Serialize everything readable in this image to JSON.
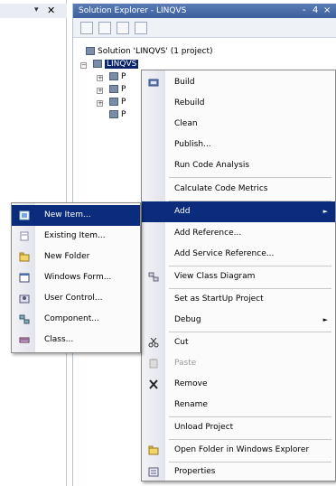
{
  "solution_explorer": {
    "title": "Solution Explorer - LINQVS",
    "solution_label": "Solution 'LINQVS' (1 project)",
    "project_label": "LINQVS",
    "window_controls": [
      "-",
      "4",
      "×"
    ],
    "child_items": [
      "P",
      "P",
      "P",
      "P"
    ]
  },
  "context_menu": {
    "items": [
      {
        "label": "Build",
        "icon": "build-icon"
      },
      {
        "label": "Rebuild",
        "icon": ""
      },
      {
        "label": "Clean",
        "icon": ""
      },
      {
        "label": "Publish...",
        "icon": ""
      },
      {
        "label": "Run Code Analysis",
        "icon": ""
      },
      {
        "label": "Calculate Code Metrics",
        "icon": ""
      },
      {
        "label": "Add",
        "icon": "",
        "submenu": true
      },
      {
        "label": "Add Reference...",
        "icon": ""
      },
      {
        "label": "Add Service Reference...",
        "icon": ""
      },
      {
        "label": "View Class Diagram",
        "icon": "class-diagram-icon"
      },
      {
        "label": "Set as StartUp Project",
        "icon": ""
      },
      {
        "label": "Debug",
        "icon": "",
        "submenu": true
      },
      {
        "label": "Cut",
        "icon": "scissors-icon"
      },
      {
        "label": "Paste",
        "icon": "paste-icon",
        "disabled": true
      },
      {
        "label": "Remove",
        "icon": "delete-icon"
      },
      {
        "label": "Rename",
        "icon": ""
      },
      {
        "label": "Unload Project",
        "icon": ""
      },
      {
        "label": "Open Folder in Windows Explorer",
        "icon": "folder-open-icon"
      },
      {
        "label": "Properties",
        "icon": "properties-icon"
      }
    ]
  },
  "add_submenu": {
    "items": [
      {
        "label": "New Item...",
        "icon": "new-item-icon"
      },
      {
        "label": "Existing Item...",
        "icon": "existing-item-icon"
      },
      {
        "label": "New Folder",
        "icon": "new-folder-icon"
      },
      {
        "label": "Windows Form...",
        "icon": "windows-form-icon"
      },
      {
        "label": "User Control...",
        "icon": "user-control-icon"
      },
      {
        "label": "Component...",
        "icon": "component-icon"
      },
      {
        "label": "Class...",
        "icon": "class-icon"
      }
    ]
  },
  "colors": {
    "highlight": "#0b2c7c",
    "title_bar": "#3c5f9d"
  }
}
